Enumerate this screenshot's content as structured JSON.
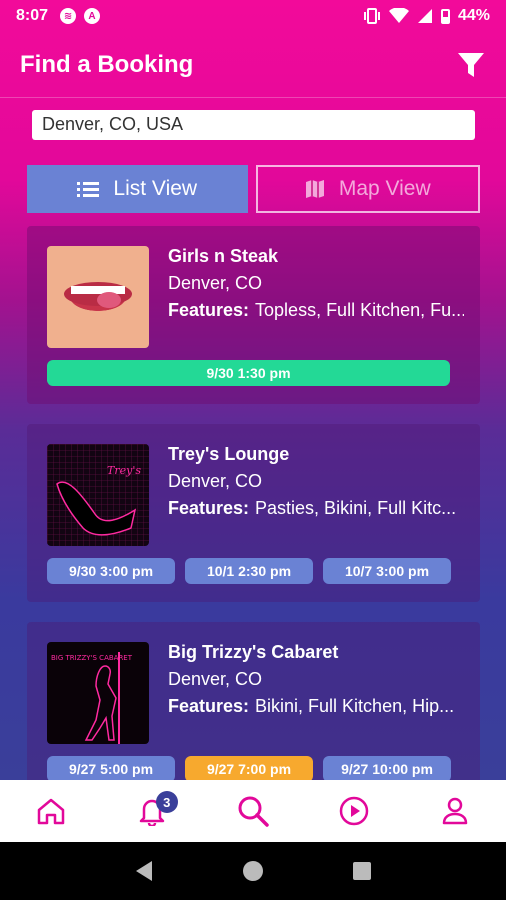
{
  "status_bar": {
    "time": "8:07",
    "battery": "44%"
  },
  "header": {
    "title": "Find a Booking"
  },
  "search": {
    "value": "Denver, CO, USA"
  },
  "view_toggle": {
    "list_label": "List View",
    "map_label": "Map View",
    "selected": "List View"
  },
  "listings": [
    {
      "name": "Girls n Steak",
      "location": "Denver, CO",
      "features_label": "Features:",
      "features": "Topless, Full Kitchen, Fu...",
      "times": [
        "9/30 1:30 pm"
      ]
    },
    {
      "name": "Trey's Lounge",
      "location": "Denver, CO",
      "features_label": "Features:",
      "features": "Pasties, Bikini, Full Kitc...",
      "times": [
        "9/30 3:00 pm",
        "10/1 2:30 pm",
        "10/7 3:00 pm"
      ]
    },
    {
      "name": "Big Trizzy's Cabaret",
      "location": "Denver, CO",
      "features_label": "Features:",
      "features": "Bikini, Full Kitchen, Hip...",
      "times": [
        "9/27 5:00 pm",
        "9/27 7:00 pm",
        "9/27 10:00 pm"
      ]
    }
  ],
  "bottom_nav": {
    "notifications_count": "3",
    "items": [
      "home-icon",
      "bell-icon",
      "search-icon",
      "play-icon",
      "profile-icon"
    ]
  },
  "colors": {
    "accent": "#e2089a",
    "primary_blue": "#6a82d4",
    "green": "#23d996",
    "orange": "#f7a92e"
  }
}
